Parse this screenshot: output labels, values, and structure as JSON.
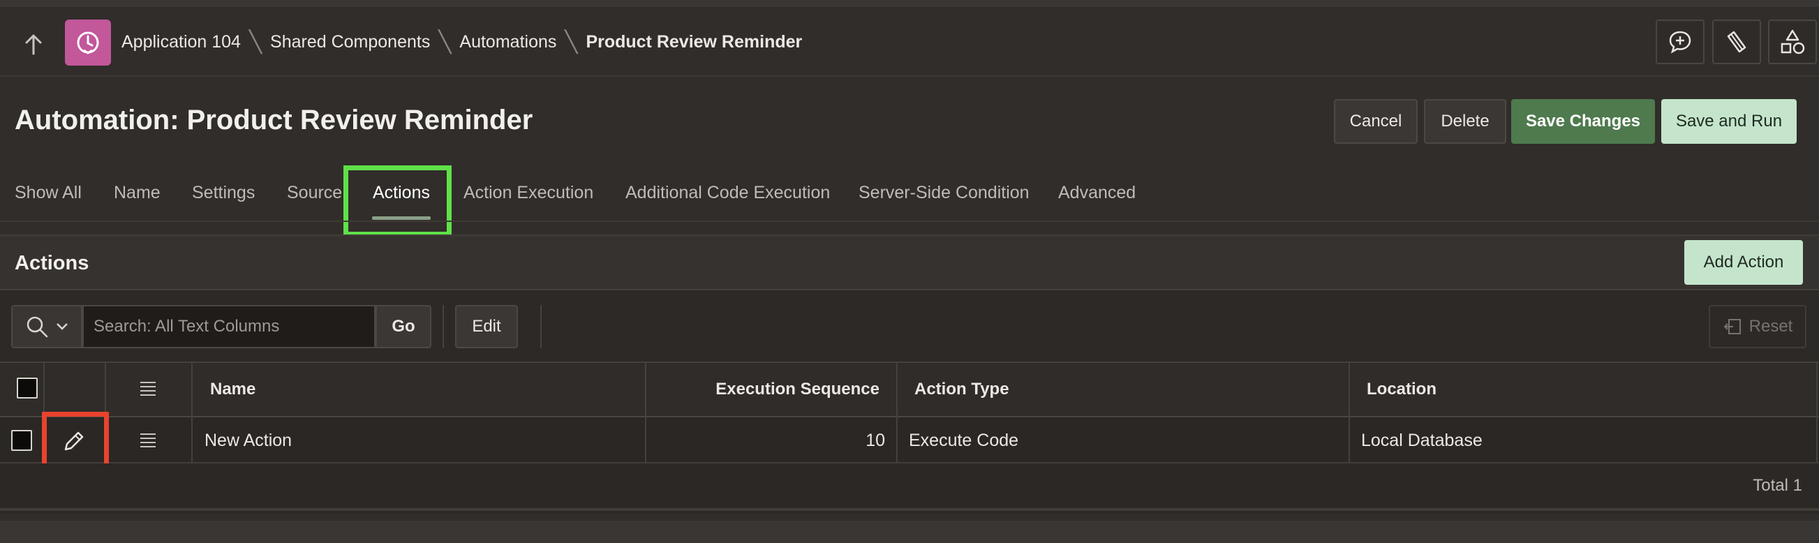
{
  "header": {
    "up_icon": "arrow-up-icon",
    "app_icon": "automation-clock-icon",
    "app_icon_color": "#c2579a",
    "breadcrumb": [
      "Application 104",
      "Shared Components",
      "Automations",
      "Product Review Reminder"
    ],
    "buttons": [
      "chat-plus-icon",
      "broom-icon",
      "shapes-icon"
    ]
  },
  "page": {
    "title": "Automation: Product Review Reminder",
    "buttons": {
      "cancel": "Cancel",
      "delete": "Delete",
      "save": "Save Changes",
      "save_and_run": "Save and Run"
    }
  },
  "tabs": [
    "Show All",
    "Name",
    "Settings",
    "Source",
    "Actions",
    "Action Execution",
    "Additional Code Execution",
    "Server-Side Condition",
    "Advanced"
  ],
  "active_tab": "Actions",
  "actions_region": {
    "title": "Actions",
    "add_button": "Add Action",
    "toolbar": {
      "search_placeholder": "Search: All Text Columns",
      "go": "Go",
      "edit": "Edit",
      "reset": "Reset"
    },
    "columns": [
      "Name",
      "Execution Sequence",
      "Action Type",
      "Location"
    ],
    "rows": [
      {
        "name": "New Action",
        "sequence": "10",
        "action_type": "Execute Code",
        "location": "Local Database"
      }
    ],
    "total": "Total 1"
  },
  "colors": {
    "background": "#312d2a",
    "primary_button": "#4f7a4e",
    "light_button": "#c4e5cc",
    "highlight_tab": "#5fe14a",
    "highlight_edit": "#e8432e"
  }
}
